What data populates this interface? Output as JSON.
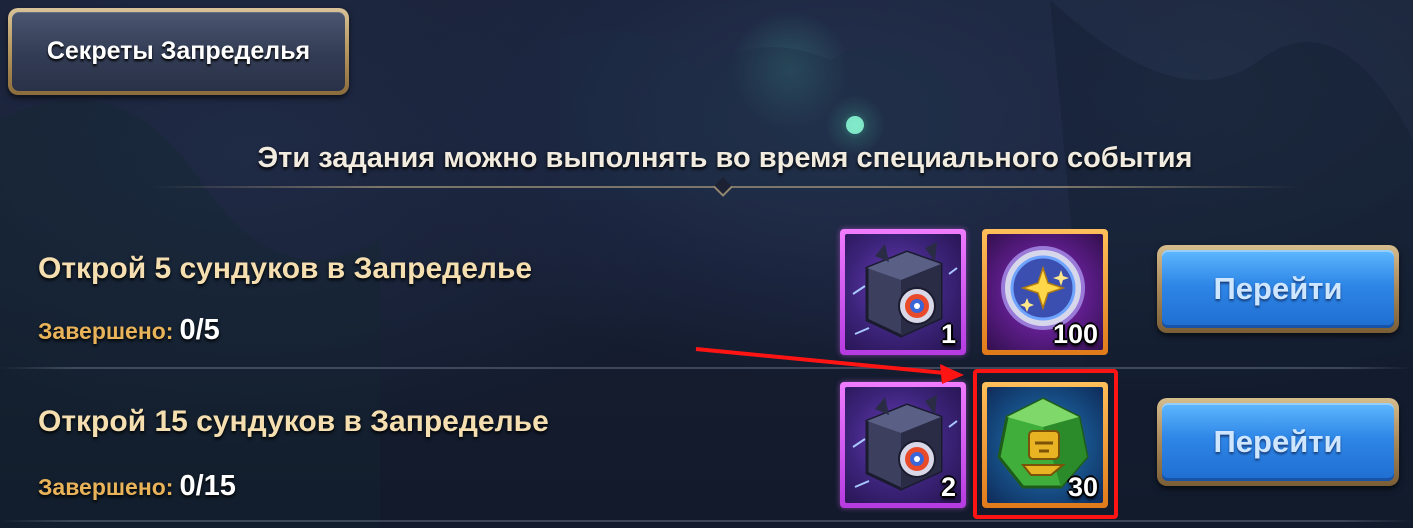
{
  "header": {
    "title": "Секреты Запределья"
  },
  "subtitle": "Эти задания можно выполнять во время специального события",
  "quests": [
    {
      "title": "Открой 5 сундуков в Запределье",
      "progress_label": "Завершено:",
      "progress_value": "0/5",
      "rewards": [
        {
          "icon": "outland-chest-icon",
          "count": "1",
          "frame": "purple"
        },
        {
          "icon": "star-coin-icon",
          "count": "100",
          "frame": "orange"
        }
      ],
      "button_label": "Перейти"
    },
    {
      "title": "Открой 15 сундуков в Запределье",
      "progress_label": "Завершено:",
      "progress_value": "0/15",
      "rewards": [
        {
          "icon": "outland-chest-icon",
          "count": "2",
          "frame": "purple"
        },
        {
          "icon": "emerald-idol-icon",
          "count": "30",
          "frame": "orange"
        }
      ],
      "button_label": "Перейти"
    }
  ],
  "annotation": {
    "highlight_color": "#ff1414"
  }
}
